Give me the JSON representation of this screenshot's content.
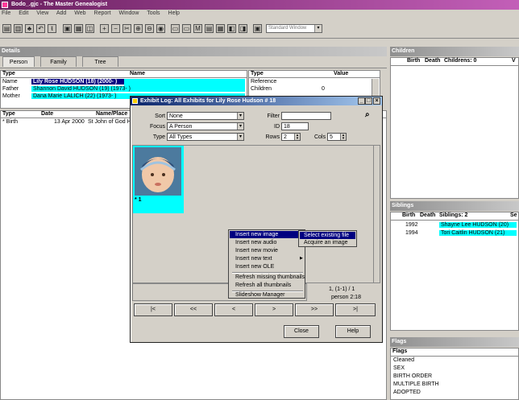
{
  "window": {
    "title": "Bodo_.gjc - The Master Genealogist"
  },
  "menu": [
    "File",
    "Edit",
    "View",
    "Add",
    "Web",
    "Report",
    "Window",
    "Tools",
    "Help"
  ],
  "toolbar": {
    "layout_combo": "Standard Window"
  },
  "details": {
    "title": "Details",
    "tabs": [
      "Person",
      "Family",
      "Tree"
    ],
    "names_headers": {
      "type": "Type",
      "name": "Name"
    },
    "names_rows": [
      {
        "type": "Name",
        "name": "Lily Rose HUDSON (18) (2000- )"
      },
      {
        "type": "Father",
        "name": "Shannon David HUDSON (19) (1973- )"
      },
      {
        "type": "Mother",
        "name": "Dana Marie LALICH (22) (1973- )"
      }
    ],
    "values_headers": {
      "type": "Type",
      "value": "Value"
    },
    "values_rows": [
      {
        "type": "Reference",
        "value": ""
      },
      {
        "type": "Children",
        "value": "0"
      }
    ],
    "events_headers": {
      "type": "Type",
      "date": "Date",
      "place": "Name/Place"
    },
    "events_rows": [
      {
        "type": "* Birth",
        "date": "13 Apr 2000",
        "place": "St John of God Ho"
      }
    ]
  },
  "children": {
    "title": "Children",
    "headers": {
      "birth": "Birth",
      "death": "Death",
      "children": "Childrens: 0",
      "extra": "V"
    }
  },
  "siblings": {
    "title": "Siblings",
    "headers": {
      "birth": "Birth",
      "death": "Death",
      "siblings": "Siblings: 2",
      "extra": "Se"
    },
    "rows": [
      {
        "birth": "1992",
        "death": "",
        "name": "Shayne Lee HUDSON (20)"
      },
      {
        "birth": "1994",
        "death": "",
        "name": "Tori Caitlin HUDSON (21)"
      }
    ]
  },
  "flags": {
    "title": "Flags",
    "header": "Flags",
    "items": [
      "Cleaned",
      "SEX",
      "BIRTH ORDER",
      "MULTIPLE BIRTH",
      "ADOPTED"
    ]
  },
  "dialog": {
    "title": "Exhibit Log: All Exhibits for Lily Rose Hudson # 18",
    "sort_label": "Sort",
    "sort_value": "None",
    "focus_label": "Focus",
    "focus_value": "A Person",
    "type_label": "Type",
    "type_value": "All Types",
    "filter_label": "Filter",
    "filter_value": "",
    "id_label": "ID",
    "id_value": "18",
    "rows_label": "Rows",
    "rows_value": "2",
    "cols_label": "Cols",
    "cols_value": "5",
    "thumb_caption": "* 1",
    "counter": "1, (1-1) / 1",
    "person": "person 2:18",
    "nav": [
      "|<",
      "<<",
      "<",
      ">",
      ">>",
      ">|"
    ],
    "close": "Close",
    "help": "Help"
  },
  "context_menu": {
    "items": [
      "Insert new image",
      "Insert new audio",
      "Insert new movie",
      "Insert new text",
      "Insert new OLE",
      "Refresh missing thumbnails",
      "Refresh all thumbnails",
      "Slideshow Manager"
    ]
  },
  "submenu": {
    "items": [
      "Select existing file",
      "Acquire an image"
    ]
  }
}
